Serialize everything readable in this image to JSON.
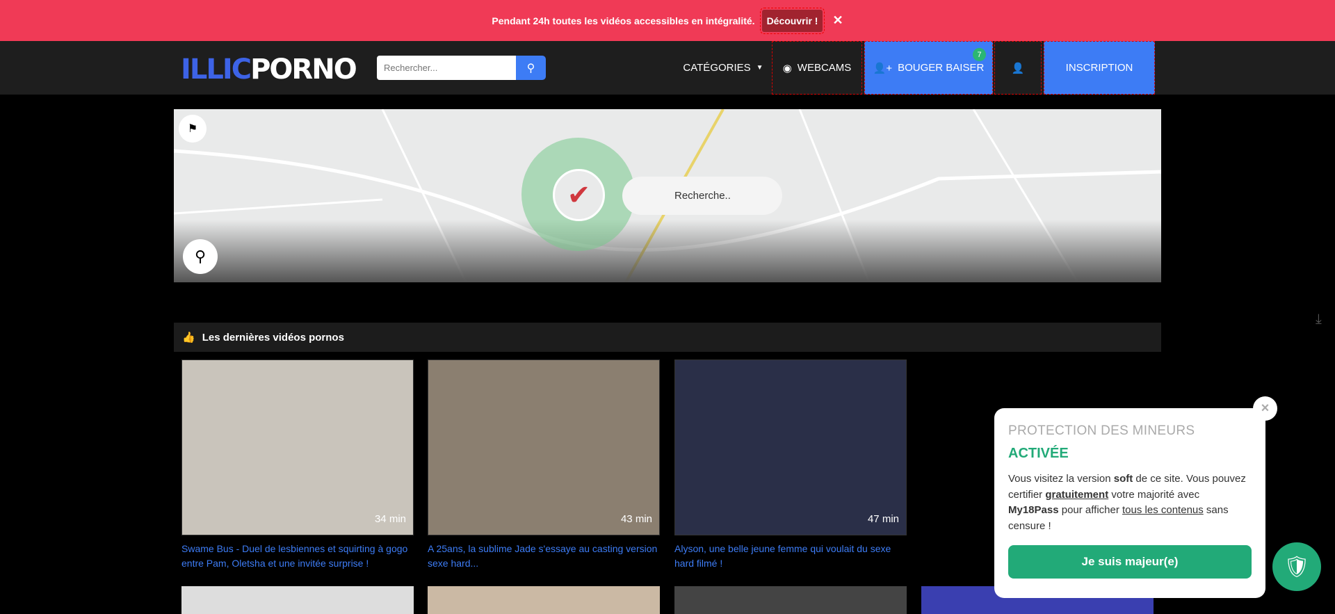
{
  "banner": {
    "text": "Pendant 24h toutes les vidéos accessibles en intégralité.",
    "cta": "Découvrir !",
    "close": "✕"
  },
  "header": {
    "logo_a": "ILLIC",
    "logo_b": "PORNO",
    "search_placeholder": "Rechercher...",
    "categories": "CATÉGORIES",
    "webcams": "WEBCAMS",
    "bouger": "BOUGER BAISER",
    "bouger_badge": "7",
    "inscription": "INSCRIPTION"
  },
  "map": {
    "search_placeholder": "Recherche.."
  },
  "section": {
    "title": "Les dernières vidéos pornos"
  },
  "videos": [
    {
      "duration": "34 min",
      "title": "Swame Bus - Duel de lesbiennes et squirting à gogo entre Pam, Oletsha et une invitée surprise !",
      "color": "#c9c4bb"
    },
    {
      "duration": "43 min",
      "title": "A 25ans, la sublime Jade s'essaye au casting version sexe hard...",
      "color": "#8b7f70"
    },
    {
      "duration": "47 min",
      "title": "Alyson, une belle jeune femme qui voulait du sexe hard filmé !",
      "color": "#2a2f48"
    }
  ],
  "popup": {
    "heading": "PROTECTION DES MINEURS",
    "status": "ACTIVÉE",
    "t1": "Vous visitez la version ",
    "soft": "soft",
    "t2": " de ce site. Vous pouvez certifier ",
    "free": "gratuitement",
    "t3": " votre majorité avec ",
    "pass": "My18Pass",
    "t4": " pour afficher ",
    "all": "tous les contenus",
    "t5": " sans censure !",
    "button": "Je suis majeur(e)",
    "close": "×"
  },
  "colors": {
    "banner": "#f03a56",
    "accent": "#3d7cf5",
    "green": "#22aa78"
  }
}
